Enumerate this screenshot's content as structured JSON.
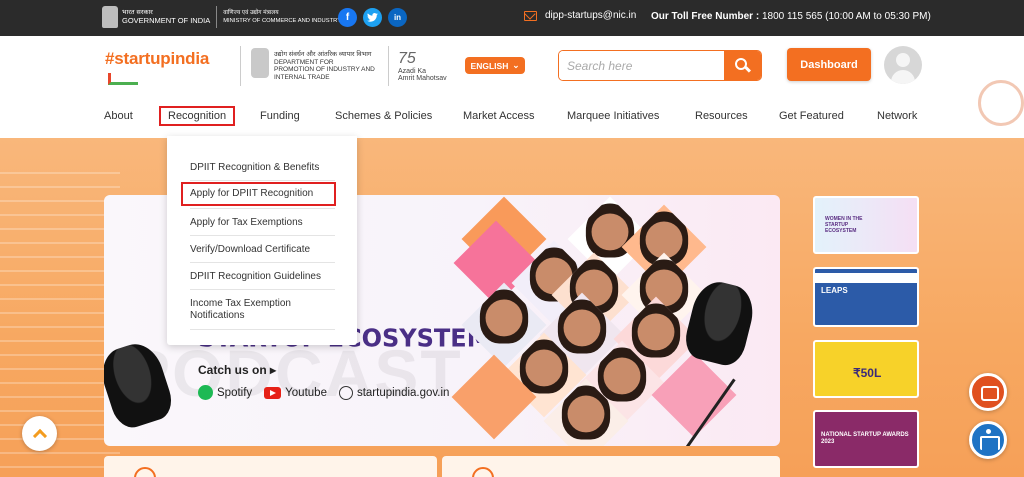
{
  "topbar": {
    "gov_hindi": "भारत सरकार",
    "gov_english": "GOVERNMENT OF INDIA",
    "ministry_hindi": "वाणिज्य एवं उद्योग मंत्रालय",
    "ministry_english": "MINISTRY OF COMMERCE AND INDUSTRY",
    "social": [
      {
        "icon": "facebook-icon",
        "glyph": "f"
      },
      {
        "icon": "twitter-icon",
        "glyph": "t"
      },
      {
        "icon": "linkedin-icon",
        "glyph": "in"
      }
    ],
    "email": "dipp-startups@nic.in",
    "toll_label": "Our Toll Free Number :",
    "toll_value": "1800 115 565 (10:00 AM to 05:30 PM)"
  },
  "header": {
    "logo_text": "#startupindia",
    "dpiit_hindi": "उद्योग संवर्धन और आंतरिक व्यापार विभाग",
    "dpiit_line1": "DEPARTMENT FOR",
    "dpiit_line2": "PROMOTION OF INDUSTRY AND",
    "dpiit_line3": "INTERNAL TRADE",
    "azadi_num": "75",
    "azadi_text1": "Azadi",
    "azadi_text2": "Ka",
    "azadi_text3": "Amrit Mahotsav",
    "language": "ENGLISH",
    "search_placeholder": "Search here",
    "dashboard": "Dashboard"
  },
  "nav": {
    "items": [
      "About",
      "Recognition",
      "Funding",
      "Schemes & Policies",
      "Market Access",
      "Marquee Initiatives",
      "Resources",
      "Get Featured",
      "Network"
    ]
  },
  "dropdown": {
    "items": [
      "DPIIT Recognition & Benefits",
      "Apply for DPIIT Recognition",
      "Apply for Tax Exemptions",
      "Verify/Download Certificate",
      "DPIIT Recognition Guidelines",
      "Income Tax Exemption Notifications"
    ]
  },
  "banner": {
    "headline": "STARTUP ECOSYSTEM",
    "watermark": "PODCAST",
    "catch": "Catch us on ▸",
    "platforms": [
      "Spotify",
      "Youtube",
      "startupindia.gov.in"
    ]
  },
  "side_cards": {
    "card1": "WOMEN IN THE STARTUP ECOSYSTEM",
    "card2": "LEAPS",
    "card3": "₹50L",
    "card4": "NATIONAL STARTUP AWARDS 2023"
  },
  "colors": {
    "brand_orange": "#f36f21",
    "highlight_red": "#e02020",
    "topbar": "#2b2b2b"
  }
}
